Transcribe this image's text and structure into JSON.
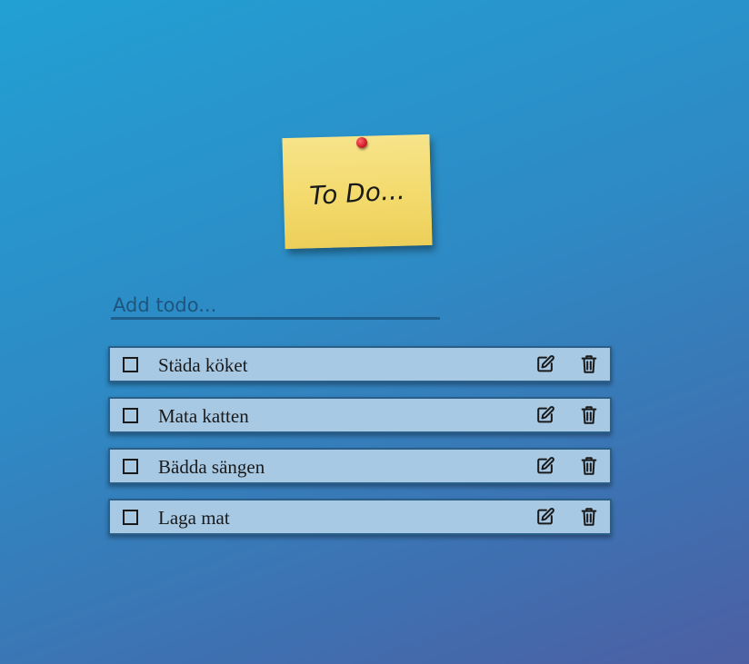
{
  "note": {
    "title": "To Do..."
  },
  "add_todo": {
    "placeholder": "Add todo..."
  },
  "todos": [
    {
      "text": "Städa köket",
      "done": false
    },
    {
      "text": "Mata katten",
      "done": false
    },
    {
      "text": "Bädda sängen",
      "done": false
    },
    {
      "text": "Laga mat",
      "done": false
    }
  ],
  "icons": {
    "checkbox": "checkbox-icon",
    "edit": "edit-icon",
    "delete": "trash-icon",
    "pin": "pushpin-icon"
  },
  "colors": {
    "background_start": "#22a0d4",
    "background_end": "#4d5fa3",
    "note": "#f3d96a",
    "item_bg": "#a8c9e4",
    "item_border": "#2a5f8a",
    "pin": "#d01c2a"
  }
}
